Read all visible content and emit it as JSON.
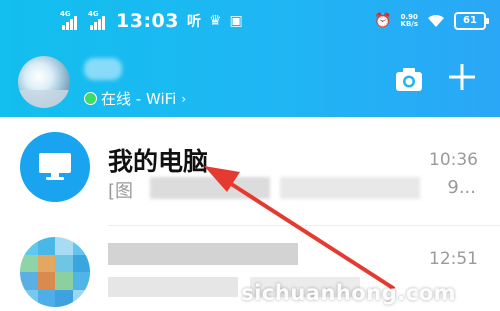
{
  "status_bar": {
    "signal1_tag": "4G",
    "signal2_tag": "4G",
    "time": "13:03",
    "hd_label": "听",
    "alarm_icon": "alarm-icon",
    "speed_value": "0.90",
    "speed_unit": "KB/s",
    "wifi_icon": "wifi-icon",
    "battery_level": "61"
  },
  "header": {
    "online_status": "在线 - WiFi",
    "camera_icon": "camera-icon",
    "add_icon": "plus-icon"
  },
  "conversations": [
    {
      "title": "我的电脑",
      "time": "10:36",
      "preview_prefix": "[图",
      "preview_suffix": "9...",
      "avatar_icon": "monitor-icon"
    },
    {
      "title": "",
      "time": "12:51",
      "avatar_icon": "mosaic-avatar"
    }
  ],
  "watermark": "sichuanhong.com",
  "colors": {
    "header_start": "#12bfee",
    "header_end": "#2aa7f6",
    "pc_avatar": "#1aa3ee",
    "arrow": "#e53a2f",
    "online_dot": "#3ddc64"
  }
}
